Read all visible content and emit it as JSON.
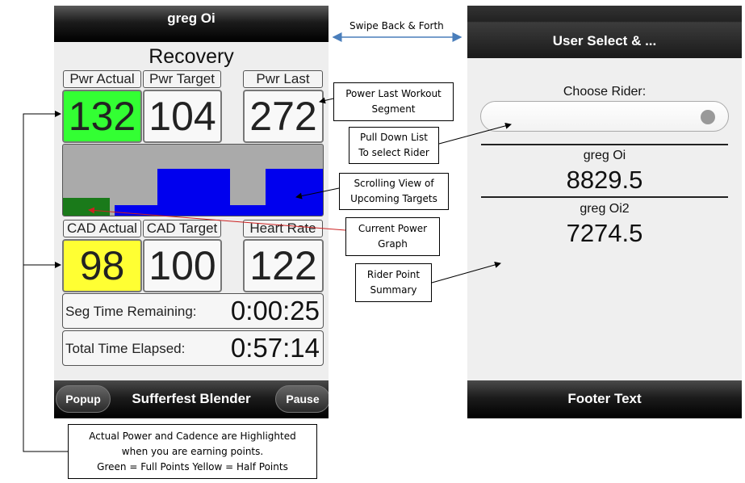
{
  "left_screen": {
    "top_bar_title": "greg Oi",
    "workout_name": "Recovery",
    "labels": {
      "pwr_actual": "Pwr Actual",
      "pwr_target": "Pwr Target",
      "pwr_last": "Pwr Last",
      "cad_actual": "CAD Actual",
      "cad_target": "CAD Target",
      "heart_rate": "Heart Rate"
    },
    "values": {
      "pwr_actual": "132",
      "pwr_target": "104",
      "pwr_last": "272",
      "cad_actual": "98",
      "cad_target": "100",
      "heart_rate": "122"
    },
    "highlight_colors": {
      "pwr_actual": "#33ff33",
      "cad_actual": "#ffff33"
    },
    "graph": {
      "target_color": "#0000ee",
      "current_color": "#1a7a1a",
      "background_color": "#aaaaaa"
    },
    "seg_time_label": "Seg Time Remaining:",
    "seg_time_value": "0:00:25",
    "total_time_label": "Total Time Elapsed:",
    "total_time_value": "0:57:14",
    "footer": {
      "popup_label": "Popup",
      "title": "Sufferfest Blender",
      "pause_label": "Pause"
    }
  },
  "right_screen": {
    "top_bar_title": "User Select & ...",
    "choose_label": "Choose Rider:",
    "riders": [
      {
        "name": "greg Oi",
        "points": "8829.5"
      },
      {
        "name": "greg Oi2",
        "points": "7274.5"
      }
    ],
    "footer_text": "Footer Text"
  },
  "annotations": {
    "swipe": "Swipe Back & Forth",
    "power_last": [
      "Power Last Workout",
      "Segment"
    ],
    "pull_down": [
      "Pull Down List",
      "To select Rider"
    ],
    "scrolling": [
      "Scrolling View of",
      "Upcoming Targets"
    ],
    "current_power": [
      "Current Power",
      "Graph"
    ],
    "rider_summary": [
      "Rider Point",
      "Summary"
    ],
    "highlight": [
      "Actual Power and Cadence are Highlighted",
      "when you are earning points.",
      "Green = Full Points Yellow = Half Points"
    ]
  }
}
